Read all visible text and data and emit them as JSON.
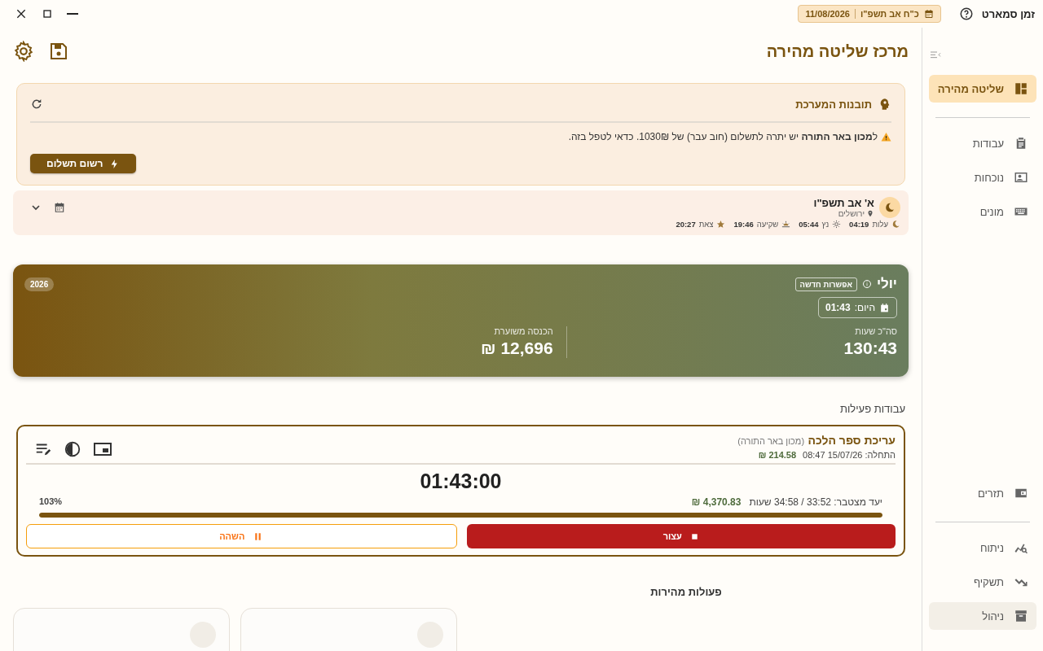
{
  "window": {
    "title": "זמן סמארט",
    "hebrew_date": "כ\"ח אב תשפ\"ו",
    "date": "11/08/2026"
  },
  "page": {
    "title": "מרכז שליטה מהירה"
  },
  "insights": {
    "title": "תובנות המערכת",
    "message": "ל**מכון באר התורה** יש יתרה לתשלום (חוב עבר) של 1030₪. כדאי לטפל בזה.",
    "button": "רשום תשלום"
  },
  "day": {
    "hebrew_date": "א' אב תשפ\"ו",
    "location": "ירושלים",
    "times": [
      {
        "label": "עלות",
        "time": "04:19"
      },
      {
        "label": "נץ",
        "time": "05:44"
      },
      {
        "label": "שקיעה",
        "time": "19:46"
      },
      {
        "label": "צאת",
        "time": "20:27"
      }
    ]
  },
  "month": {
    "name": "יולי",
    "badge": "אפשרות חדשה",
    "year": "2026",
    "today_label": "היום:",
    "today_value": "01:43",
    "stats": [
      {
        "label": "סה\"כ שעות",
        "value": "130:43"
      },
      {
        "label": "הכנסה משוערת",
        "value": "12,696 ₪"
      }
    ]
  },
  "active_jobs": {
    "title": "עבודות פעילות",
    "jobs": [
      {
        "name": "עריכת ספר הלכה",
        "client": "(מכון באר התורה)",
        "start": "התחלה: 15/07/26 08:47",
        "earned": "214.58 ₪",
        "timer": "01:43:00",
        "target": "יעד מצטבר: 33:52 / 34:58 שעות",
        "target_amount": "4,370.83 ₪",
        "percent": "103%",
        "level": 1,
        "buttons": [
          {
            "kind": "stop",
            "label": "עצור"
          },
          {
            "kind": "pause",
            "label": "השהה"
          }
        ]
      }
    ]
  },
  "quick_actions": {
    "title": "פעולות מהירות",
    "cards": [
      {
        "kind": "action"
      },
      {
        "kind": "action"
      }
    ]
  },
  "sidebar": {
    "top": [
      {
        "items": [
          {
            "label": "שליטה מהירה",
            "selected": true,
            "highlighted": false
          }
        ]
      },
      {
        "items": [
          {
            "label": "עבודות",
            "selected": false,
            "highlighted": false
          },
          {
            "label": "נוכחות",
            "selected": false,
            "highlighted": false
          },
          {
            "label": "מונים",
            "selected": false,
            "highlighted": false
          }
        ]
      }
    ],
    "bottom": [
      {
        "items": [
          {
            "label": "תזרים",
            "selected": false,
            "highlighted": false
          }
        ]
      },
      {
        "items": [
          {
            "label": "ניתוח",
            "selected": false,
            "highlighted": false
          },
          {
            "label": "תשקיף",
            "selected": false,
            "highlighted": false
          },
          {
            "label": "ניהול",
            "selected": false,
            "highlighted": true
          }
        ]
      }
    ]
  }
}
